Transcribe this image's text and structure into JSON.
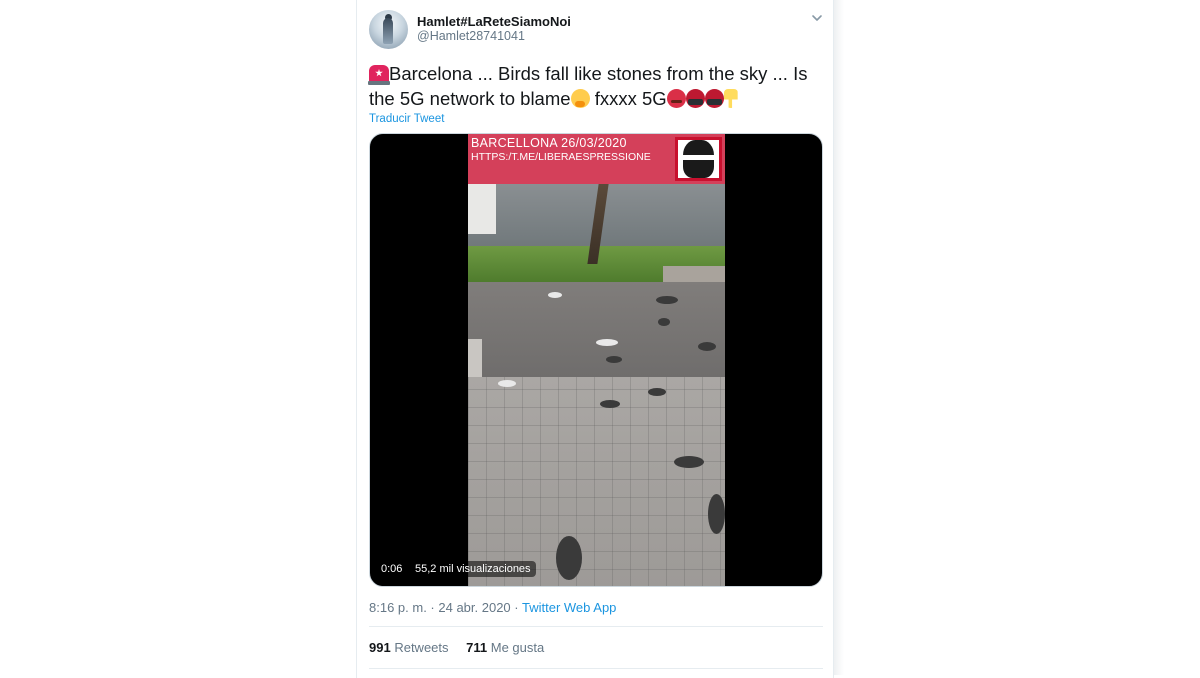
{
  "author": {
    "display_name": "Hamlet#LaReteSiamoNoi",
    "handle": "@Hamlet28741041",
    "avatar_icon": "avatar-photo"
  },
  "menu_icon": "chevron-down-icon",
  "tweet": {
    "part1": "Barcelona ... Birds fall like stones from the sky ... Is the 5G network to blame",
    "part2": " fxxxx 5G",
    "emojis": [
      "rotating-light",
      "thinking-face",
      "angry-face",
      "face-with-symbols-on-mouth",
      "face-with-symbols-on-mouth",
      "backhand-index-pointing-down"
    ],
    "translate_label": "Traducir Tweet"
  },
  "video": {
    "overlay_title": "BARCELLONA 26/03/2020",
    "overlay_url": "HTTPS:/T.ME/LIBERAESPRESSIONE",
    "duration": "0:06",
    "views": "55,2 mil visualizaciones"
  },
  "meta": {
    "time": "8:16 p. m.",
    "separator": " · ",
    "date": "24 abr. 2020",
    "source": "Twitter Web App"
  },
  "stats": {
    "retweets_count": "991",
    "retweets_label": "Retweets",
    "likes_count": "711",
    "likes_label": "Me gusta"
  },
  "colors": {
    "link": "#1b95e0",
    "text": "#14171a",
    "muted": "#657786",
    "banner": "#d4405a"
  }
}
